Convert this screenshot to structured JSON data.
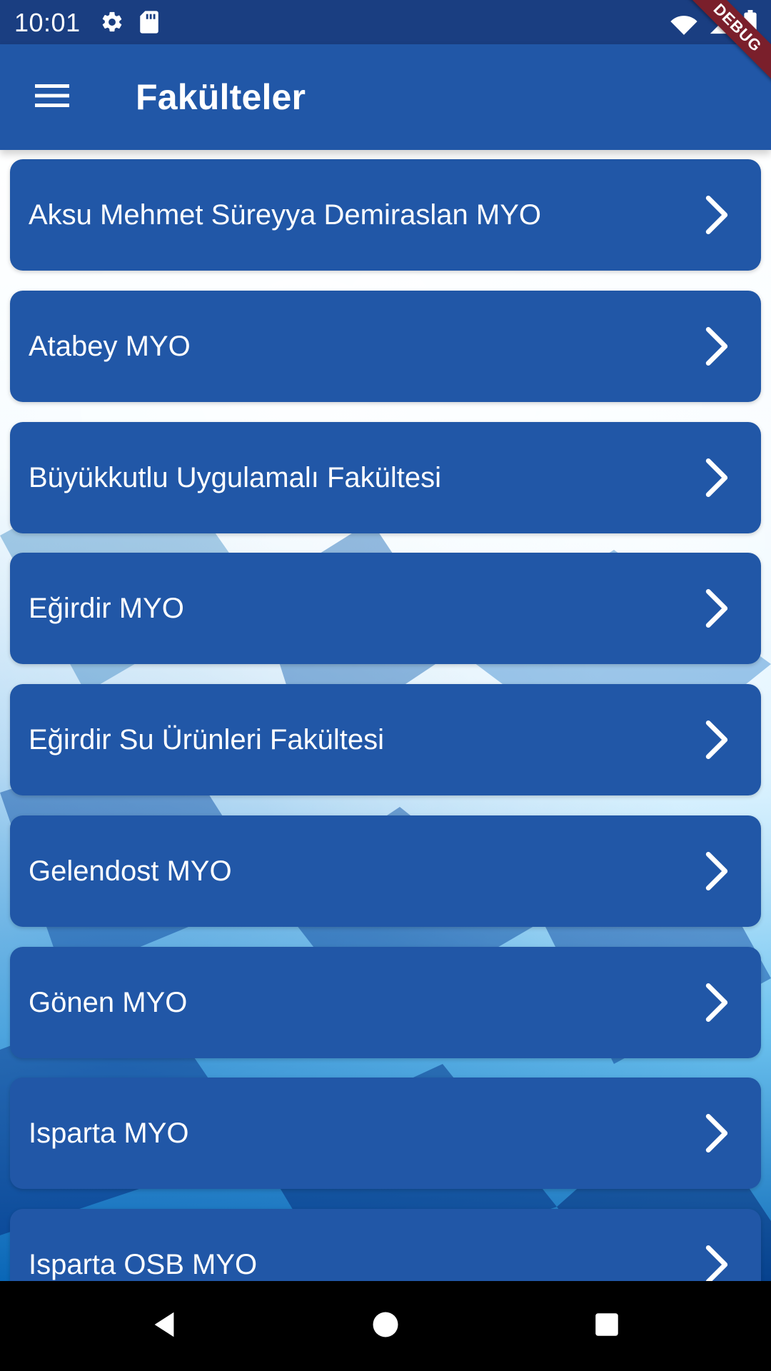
{
  "status_bar": {
    "time": "10:01",
    "icons_left": [
      "gear-icon",
      "sd-card-icon"
    ],
    "icons_right": [
      "wifi-icon",
      "signal-icon",
      "battery-icon"
    ],
    "background": "#1a3e81"
  },
  "debug_ribbon": {
    "text": "DEBUG",
    "color": "#7a1f2b"
  },
  "app_bar": {
    "title": "Fakülteler",
    "menu_icon": "hamburger-menu-icon",
    "background": "#2157a7"
  },
  "list": {
    "item_background": "#2157a7",
    "chevron_icon": "chevron-right-icon",
    "items": [
      {
        "label": "Aksu Mehmet Süreyya Demiraslan MYO"
      },
      {
        "label": "Atabey MYO"
      },
      {
        "label": "Büyükkutlu Uygulamalı Fakültesi"
      },
      {
        "label": "Eğirdir MYO"
      },
      {
        "label": "Eğirdir Su Ürünleri Fakültesi"
      },
      {
        "label": "Gelendost MYO"
      },
      {
        "label": "Gönen MYO"
      },
      {
        "label": "Isparta MYO"
      },
      {
        "label": "Isparta OSB MYO"
      }
    ]
  },
  "nav_bar": {
    "buttons": [
      "back-icon",
      "home-icon",
      "recents-icon"
    ],
    "background": "#000000"
  }
}
